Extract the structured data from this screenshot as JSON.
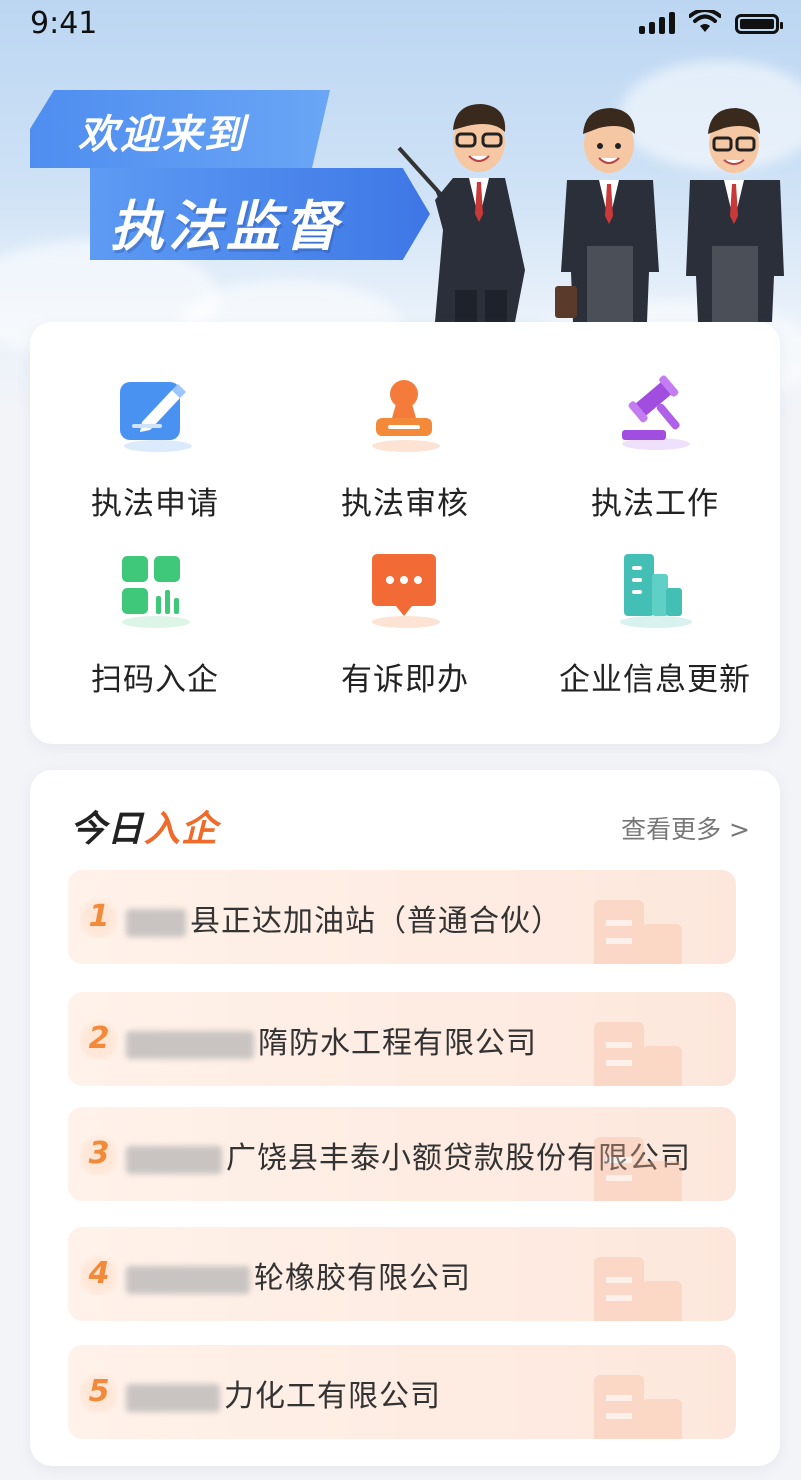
{
  "status_bar": {
    "time": "9:41"
  },
  "hero": {
    "line1": "欢迎来到",
    "line2": "执法监督"
  },
  "menu": [
    {
      "label": "执法申请",
      "icon": "edit-icon",
      "color": "#3f8ef0"
    },
    {
      "label": "执法审核",
      "icon": "stamp-icon",
      "color": "#f38a3a"
    },
    {
      "label": "执法工作",
      "icon": "gavel-icon",
      "color": "#a04de0"
    },
    {
      "label": "扫码入企",
      "icon": "qr-scan-icon",
      "color": "#3fc77a"
    },
    {
      "label": "有诉即办",
      "icon": "message-icon",
      "color": "#f26a35"
    },
    {
      "label": "企业信息更新",
      "icon": "building-icon",
      "color": "#43bfb6"
    }
  ],
  "today_section": {
    "title_dark": "今日",
    "title_accent": "入企",
    "more_label": "查看更多 >",
    "items": [
      {
        "num": "1",
        "name": "县正达加油站（普通合伙）"
      },
      {
        "num": "2",
        "name": "隋防水工程有限公司"
      },
      {
        "num": "3",
        "name": "广饶县丰泰小额贷款股份有限公司"
      },
      {
        "num": "4",
        "name": "轮橡胶有限公司"
      },
      {
        "num": "5",
        "name": "力化工有限公司"
      }
    ]
  }
}
